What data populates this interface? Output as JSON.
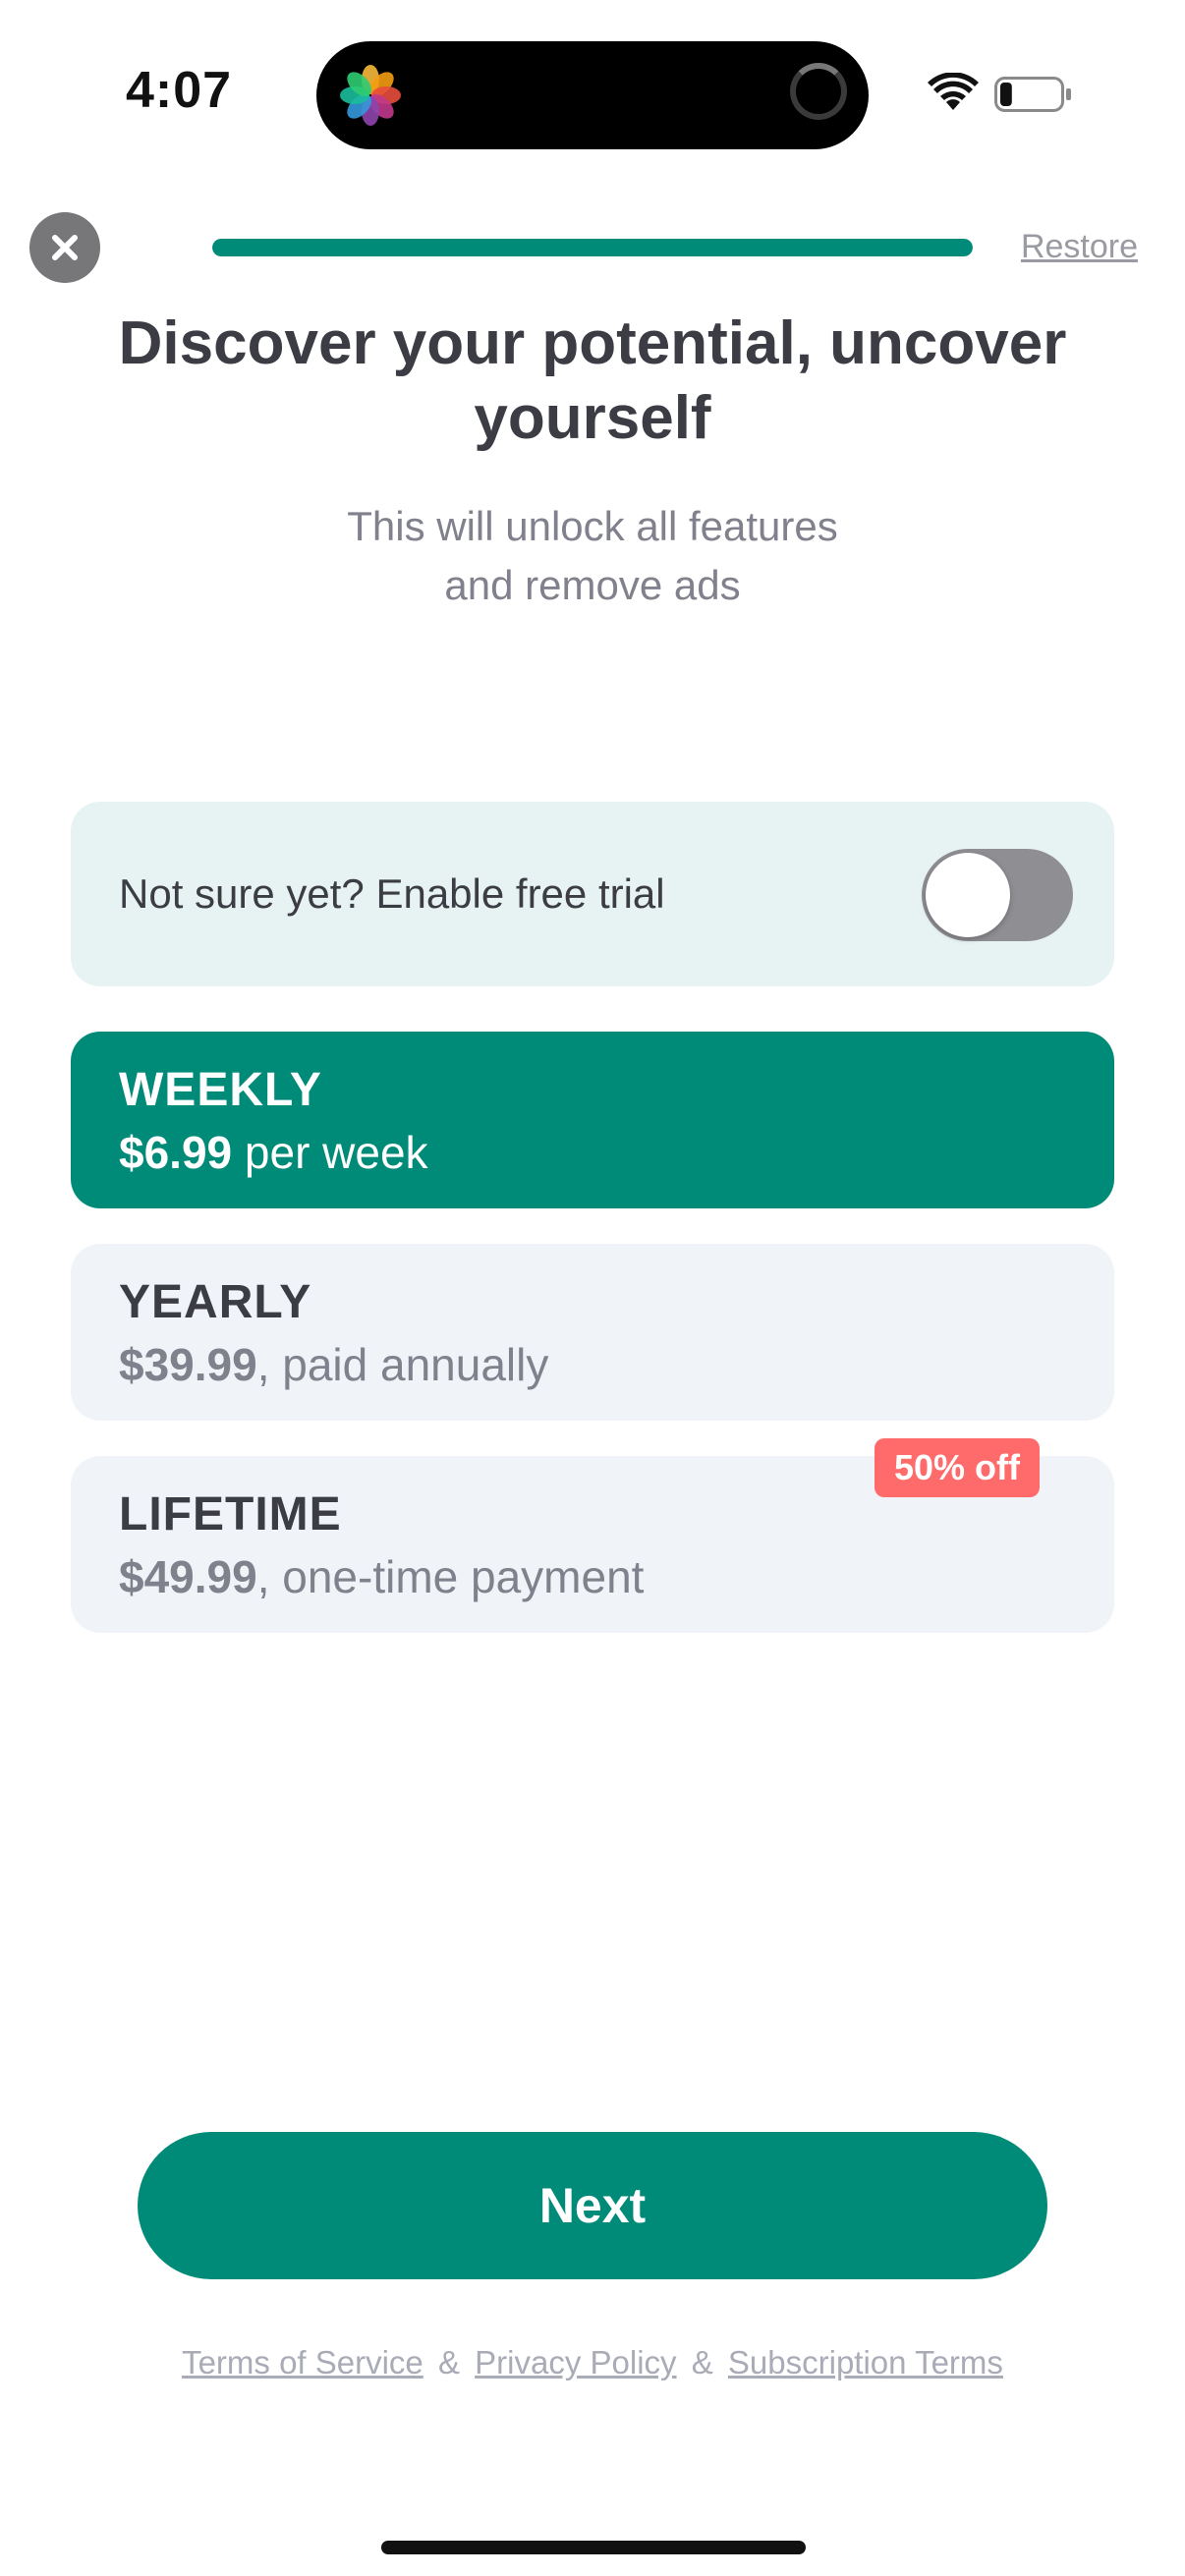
{
  "status_bar": {
    "time": "4:07",
    "app_icon": "photos-icon",
    "activity_icon": "spinner-icon",
    "wifi_icon": "wifi-icon",
    "battery_icon": "battery-low-icon",
    "battery_level": 0.2
  },
  "header": {
    "close_icon": "close-icon",
    "progress": 1.0,
    "restore_label": "Restore"
  },
  "title": "Discover your potential, uncover yourself",
  "subtitle_line1": "This will unlock all features",
  "subtitle_line2": "and remove ads",
  "trial": {
    "label": "Not sure yet? Enable free trial",
    "enabled": false
  },
  "plans": [
    {
      "name": "WEEKLY",
      "price": "$6.99",
      "suffix": " per week",
      "selected": true
    },
    {
      "name": "YEARLY",
      "price": "$39.99",
      "suffix": ", paid annually",
      "selected": false
    },
    {
      "name": "LIFETIME",
      "price": "$49.99",
      "suffix": ", one-time payment",
      "selected": false,
      "badge": "50% off"
    }
  ],
  "next_label": "Next",
  "footer": {
    "terms": "Terms of Service",
    "privacy": "Privacy Policy",
    "subscription": "Subscription Terms",
    "separator": "&"
  },
  "colors": {
    "accent": "#008a78",
    "badge": "#ff6b6b",
    "card": "#f0f3f8",
    "trial_card": "#e7f3f2"
  }
}
